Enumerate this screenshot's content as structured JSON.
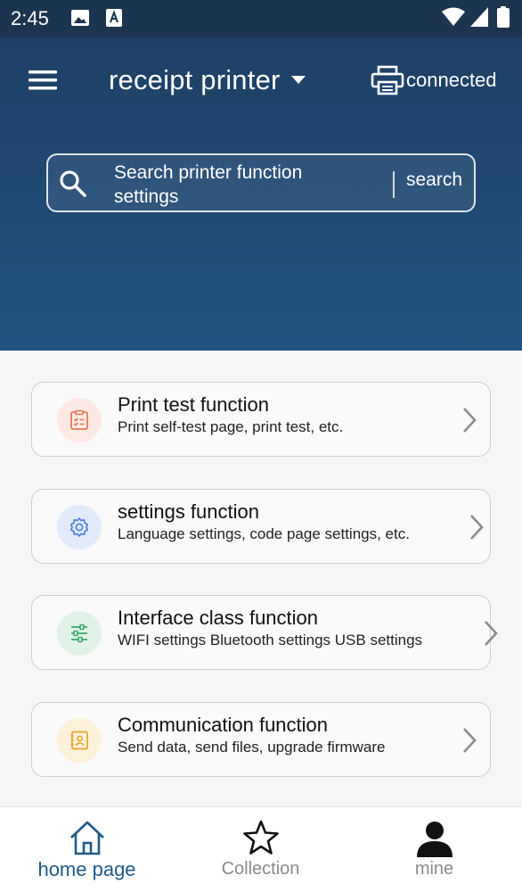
{
  "status_bar": {
    "time": "2:45",
    "icons": [
      "image-icon",
      "a-badge-icon",
      "wifi-icon",
      "signal-icon",
      "battery-icon"
    ]
  },
  "header": {
    "title": "receipt printer",
    "printer_status": "connected",
    "menu_icon": "hamburger-menu-icon",
    "printer_icon": "printer-icon"
  },
  "search": {
    "placeholder": "Search printer function settings",
    "value": "",
    "button_label": "search"
  },
  "functions": [
    {
      "title": "Print test function",
      "subtitle": "Print self-test page, print test, etc.",
      "icon": "clipboard-checklist-icon",
      "accent": "#e8765a",
      "bg": "#fde9e3"
    },
    {
      "title": "settings function",
      "subtitle": "Language settings, code page settings, etc.",
      "icon": "gear-icon",
      "accent": "#4f7fe0",
      "bg": "#e3ebfb"
    },
    {
      "title": "Interface class function",
      "subtitle": "WIFI settings Bluetooth settings USB settings",
      "icon": "sliders-icon",
      "accent": "#3aa86a",
      "bg": "#e1f3e8"
    },
    {
      "title": "Communication function",
      "subtitle": "Send data, send files, upgrade firmware",
      "icon": "contact-card-icon",
      "accent": "#e6a52a",
      "bg": "#fdf1d9"
    }
  ],
  "bottom_nav": [
    {
      "label": "home page",
      "icon": "home-icon",
      "active": true
    },
    {
      "label": "Collection",
      "icon": "star-icon",
      "active": false
    },
    {
      "label": "mine",
      "icon": "user-icon",
      "active": false
    }
  ],
  "colors": {
    "header_top": "#1d3e62",
    "header_bottom": "#235380",
    "nav_active": "#1f5a88",
    "nav_inactive": "#8a8a8a"
  }
}
